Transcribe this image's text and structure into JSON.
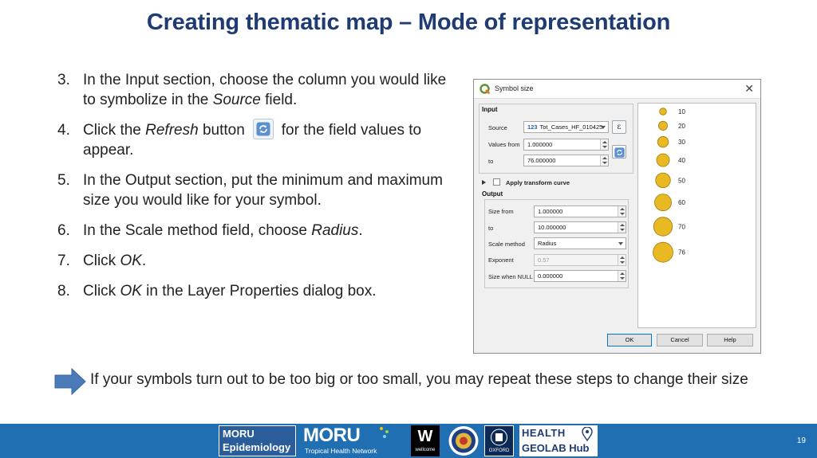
{
  "slide": {
    "title": "Creating thematic map – Mode of representation",
    "page_number": "19"
  },
  "steps": [
    {
      "num": "3.",
      "parts": [
        "In the Input section, choose the column you would like to symbolize in the ",
        "Source",
        " field."
      ]
    },
    {
      "num": "4.",
      "parts": [
        "Click the ",
        "Refresh",
        " button",
        "for the field values to appear."
      ]
    },
    {
      "num": "5.",
      "text": "In the Output section, put the minimum and maximum size you would like for your symbol."
    },
    {
      "num": "6.",
      "parts": [
        "In the Scale method field, choose ",
        "Radius",
        "."
      ]
    },
    {
      "num": "7.",
      "parts": [
        "Click ",
        "OK",
        "."
      ]
    },
    {
      "num": "8.",
      "parts": [
        "Click ",
        "OK",
        " in the Layer Properties dialog box."
      ]
    }
  ],
  "tip": {
    "text": "If your symbols turn out to be too big or too small, you may repeat these steps to change their size",
    "icon": "right-arrow-icon",
    "color": "#4a7ab8"
  },
  "dialog": {
    "title": "Symbol size",
    "close_glyph": "✕",
    "input_label": "Input",
    "source_label": "Source",
    "source_type": "123",
    "source_value": "Tot_Cases_HF_010425",
    "values_from_label": "Values from",
    "values_from": "1.000000",
    "to_label": "to",
    "values_to": "76.000000",
    "apply_transform_label": "Apply transform curve",
    "output_label": "Output",
    "size_from_label": "Size from",
    "size_from": "1.000000",
    "size_to_label": "to",
    "size_to": "10.000000",
    "scale_method_label": "Scale method",
    "scale_method": "Radius",
    "exponent_label": "Exponent",
    "exponent": "0.57",
    "size_null_label": "Size when NULL",
    "size_null": "0.000000",
    "epsilon_glyph": "ε",
    "ok_label": "OK",
    "cancel_label": "Cancel",
    "help_label": "Help",
    "legend": [
      {
        "label": "10",
        "value": 10
      },
      {
        "label": "20",
        "value": 20
      },
      {
        "label": "30",
        "value": 30
      },
      {
        "label": "40",
        "value": 40
      },
      {
        "label": "50",
        "value": 50
      },
      {
        "label": "60",
        "value": 60
      },
      {
        "label": "70",
        "value": 70
      },
      {
        "label": "76",
        "value": 76
      }
    ],
    "symbol_color": "#e8b923",
    "symbol_stroke": "#9c7a12"
  },
  "footer": {
    "bg_color": "#1f6fb2",
    "logos": [
      {
        "name": "moru-epidemiology-logo",
        "lines": [
          "MORU",
          "Epidemiology"
        ]
      },
      {
        "name": "moru-tropical-logo",
        "lines": [
          "MORU",
          "Tropical Health Network"
        ]
      },
      {
        "name": "wellcome-logo",
        "lines": [
          "W",
          "wellcome"
        ]
      },
      {
        "name": "mahidol-seal-logo",
        "lines": []
      },
      {
        "name": "oxford-logo",
        "lines": [
          "OXFORD"
        ]
      },
      {
        "name": "health-geolab-logo",
        "lines": [
          "HEALTH",
          "GEOLAB Hub"
        ]
      }
    ]
  }
}
